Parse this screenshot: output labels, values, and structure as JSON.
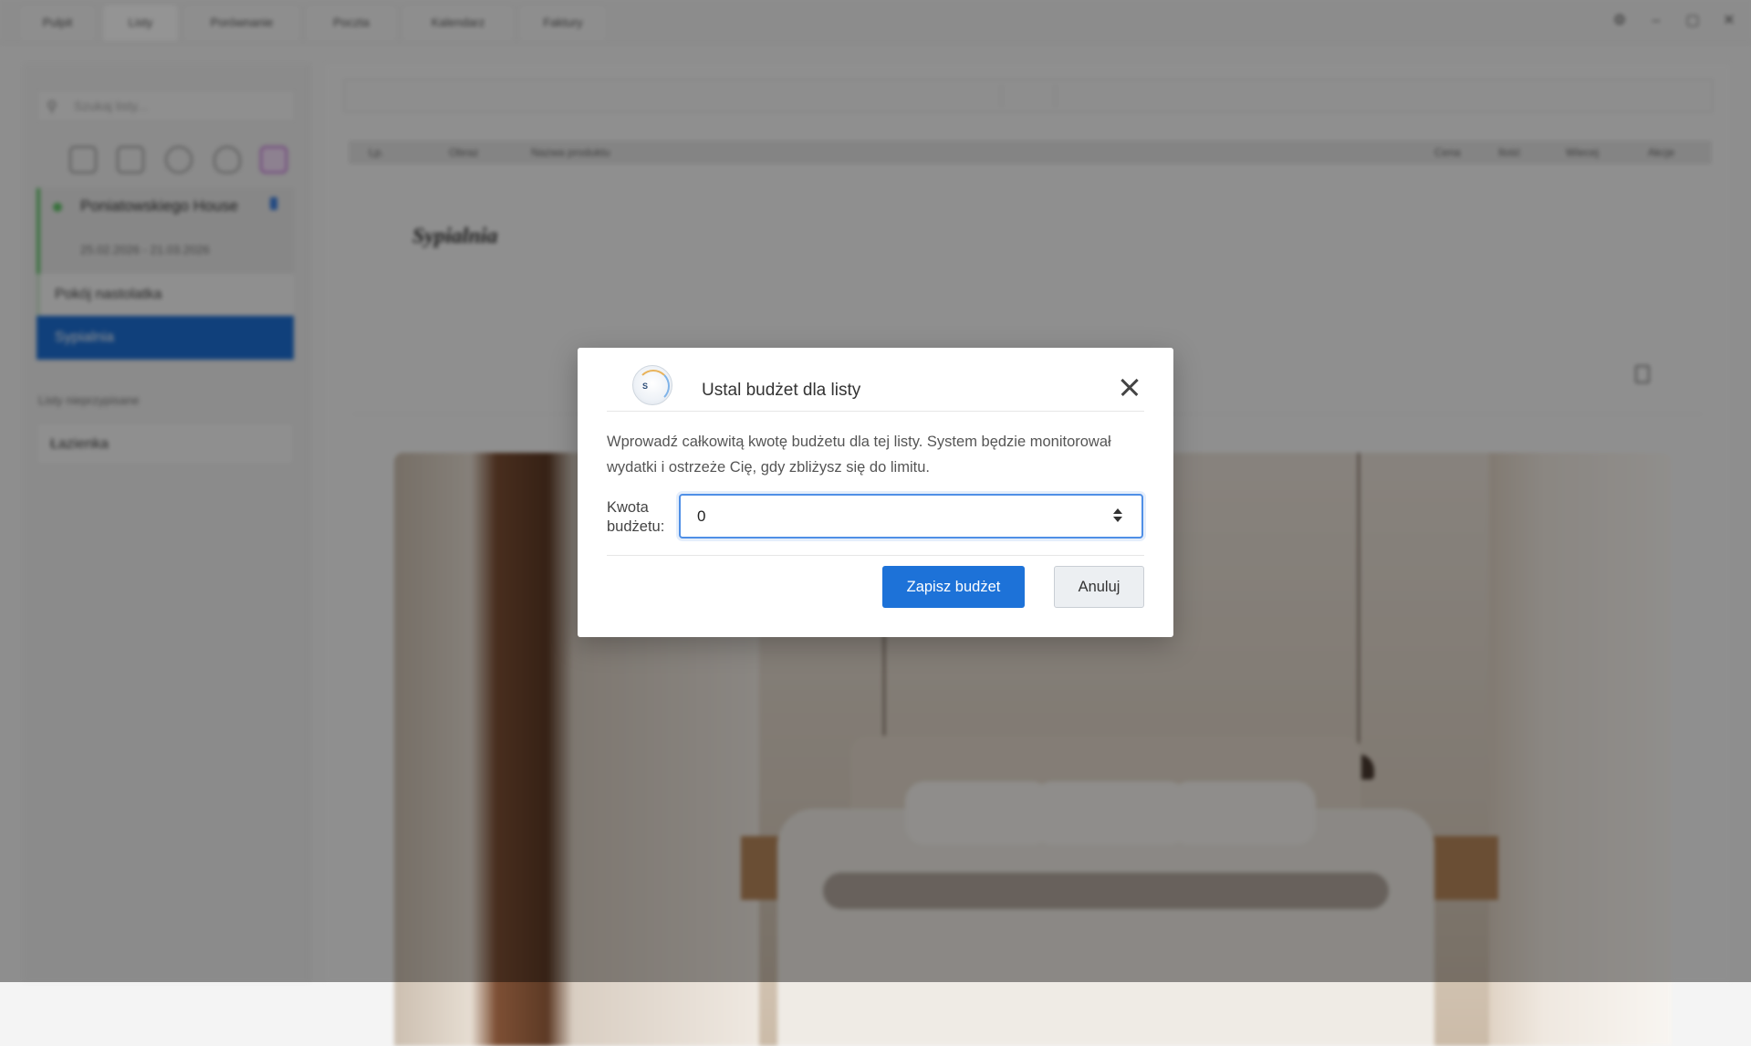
{
  "app": {
    "tabs": [
      {
        "label": "Pulpit"
      },
      {
        "label": "Listy"
      },
      {
        "label": "Porównanie"
      },
      {
        "label": "Poczta"
      },
      {
        "label": "Kalendarz"
      },
      {
        "label": "Faktury"
      }
    ],
    "active_tab_index": 1,
    "window_controls": [
      "settings-icon",
      "minimize-icon",
      "maximize-icon",
      "close-icon"
    ]
  },
  "sidebar": {
    "search_placeholder": "Szukaj listy...",
    "toolbar_icons": [
      "clipboard-icon",
      "chat-add-icon",
      "cloud-download-icon",
      "heart-icon",
      "pdf-file-icon"
    ],
    "project": {
      "name": "Poniatowskiego House",
      "dates": "25.02.2026 - 21.03.2026"
    },
    "items": [
      {
        "label": "Pokój nastolatka"
      },
      {
        "label": "Sypialnia"
      }
    ],
    "selected_item_index": 1,
    "unassigned_section_label": "Listy nieprzypisane",
    "unassigned_items": [
      {
        "label": "Łazienka"
      }
    ]
  },
  "main": {
    "table_headers": [
      "Lp.",
      "Obraz",
      "Nazwa produktu",
      "Cena",
      "Ilość",
      "Wiecej",
      "Akcje"
    ],
    "room_title": "Sypialnia"
  },
  "modal": {
    "title": "Ustal budżet dla listy",
    "description": "Wprowadź całkowitą kwotę budżetu dla tej listy. System będzie monitorował wydatki i ostrzeże Cię, gdy zbliżysz się do limitu.",
    "field_label": "Kwota budżetu:",
    "field_value": "0",
    "save_label": "Zapisz budżet",
    "cancel_label": "Anuluj",
    "logo_text": "S",
    "accent_color": "#1d72d8"
  }
}
